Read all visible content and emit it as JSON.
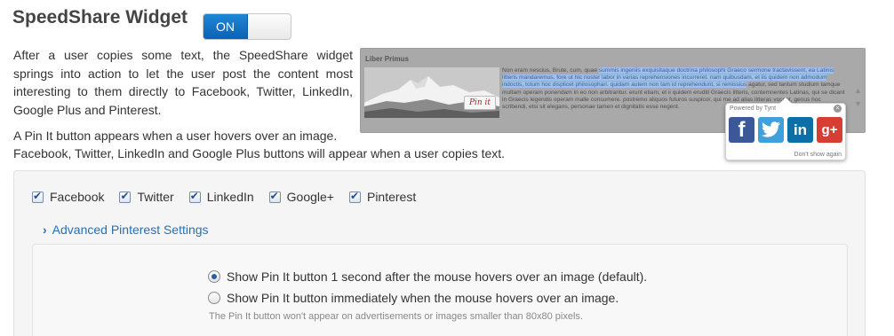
{
  "header": {
    "title": "SpeedShare Widget",
    "toggle_label": "ON"
  },
  "description": "After a user copies some text, the SpeedShare widget springs into action to let the user post the content most interesting to them directly to Facebook, Twitter, LinkedIn, Google Plus and Pinterest.",
  "description_line1": "A Pin It button appears when a user hovers over an image.",
  "description_line2": "Facebook, Twitter, LinkedIn and Google Plus buttons will appear when a user copies text.",
  "preview": {
    "title": "Liber Primus",
    "pin_label": "Pin it",
    "text_before": "Non eram nescius, Brute, cum, quae ",
    "text_highlighted": "summis ingeniis exquisitaque doctrina philosophi Graeco sermone tractavissent, ea Latinis litteris mandaremus, fore ut hic noster labor in varias reprehensiones incurreret. nam quibusdam, et iis quidem non admodum indoctis, totum hoc displicet philosophari. quidam autem non tam id reprehendunt, si remissius",
    "text_after": " agatur, sed tantum studium tamque multam operam ponendam in eo non arbitrantur. erunt etiam, et ii quidem eruditi Graecis litteris, contemnentes Latinas, qui se dicant in Graecis legendis operam malle consumere. postremo aliquos futuros suspicor, qui me ad alias litteras vocent, genus hoc scribendi, etsi sit elegans, personae tamen et dignitatis esse negent.",
    "popup": {
      "powered_by": "Powered by Tynt",
      "dont_show": "Don't show again",
      "icons": [
        "facebook-icon",
        "twitter-icon",
        "linkedin-icon",
        "google-plus-icon"
      ]
    }
  },
  "networks": [
    {
      "label": "Facebook",
      "checked": true
    },
    {
      "label": "Twitter",
      "checked": true
    },
    {
      "label": "LinkedIn",
      "checked": true
    },
    {
      "label": "Google+",
      "checked": true
    },
    {
      "label": "Pinterest",
      "checked": true
    }
  ],
  "advanced": {
    "label": "Advanced Pinterest Settings",
    "options": [
      {
        "label": "Show Pin It button 1 second after the mouse hovers over an image (default).",
        "selected": true
      },
      {
        "label": "Show Pin It button immediately when the mouse hovers over an image.",
        "selected": false
      }
    ],
    "note": "The Pin It button won't appear on advertisements or images smaller than 80x80 pixels."
  },
  "colors": {
    "toggle_on": "#1175c9",
    "link": "#2a6fb1",
    "facebook": "#3b5998",
    "twitter": "#3fa0dc",
    "linkedin": "#0d6fa8",
    "google_plus": "#d73d32"
  }
}
